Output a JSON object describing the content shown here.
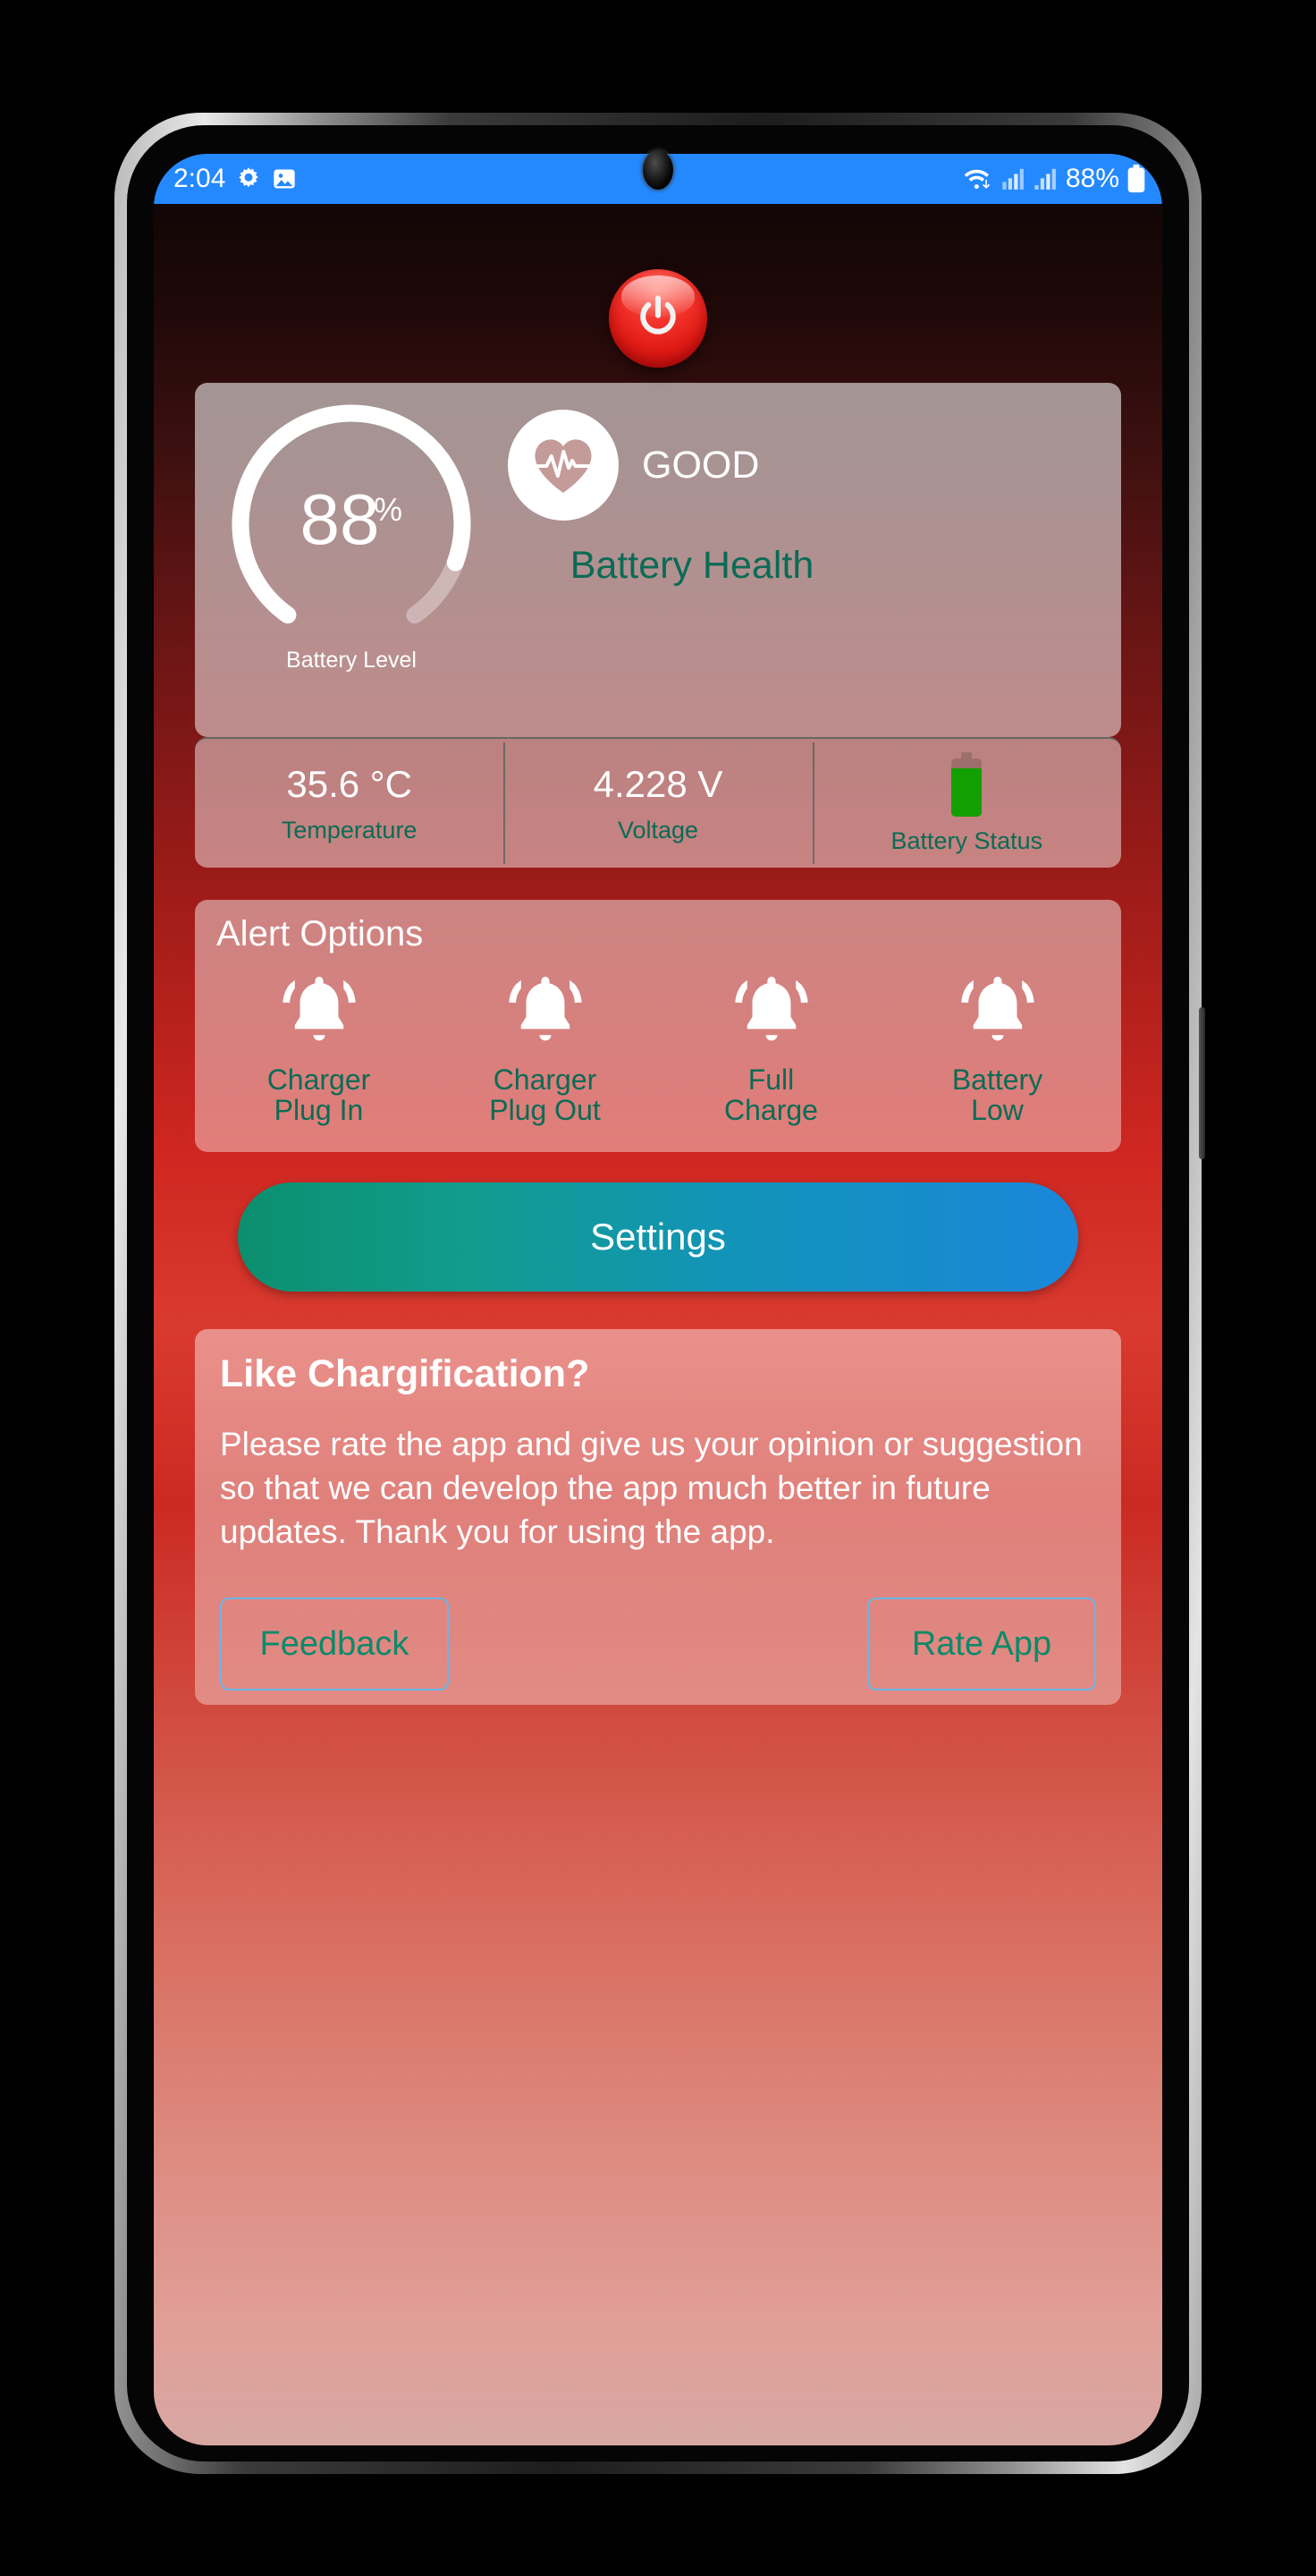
{
  "status_bar": {
    "time": "2:04",
    "left_icons": [
      "gear-icon",
      "image-icon"
    ],
    "battery_percent": "88%",
    "right_icons": [
      "wifi-icon",
      "signal-icon",
      "signal-icon",
      "battery-icon"
    ]
  },
  "power_button": {
    "icon": "power-icon"
  },
  "status_card": {
    "gauge": {
      "value": "88",
      "unit": "%",
      "label": "Battery Level",
      "percent": 88
    },
    "health": {
      "icon": "heart-pulse-icon",
      "value": "GOOD",
      "caption": "Battery Health"
    }
  },
  "metrics": [
    {
      "value": "35.6 °C",
      "label": "Temperature",
      "icon": null
    },
    {
      "value": "4.228 V",
      "label": "Voltage",
      "icon": null
    },
    {
      "value": "",
      "label": "Battery Status",
      "icon": "battery-vertical-icon"
    }
  ],
  "alerts": {
    "title": "Alert Options",
    "items": [
      {
        "icon": "bell-ring-icon",
        "label": "Charger\nPlug In"
      },
      {
        "icon": "bell-ring-icon",
        "label": "Charger\nPlug Out"
      },
      {
        "icon": "bell-ring-icon",
        "label": "Full\nCharge"
      },
      {
        "icon": "bell-ring-icon",
        "label": "Battery\nLow"
      }
    ]
  },
  "settings_button": {
    "label": "Settings"
  },
  "rate_card": {
    "title": "Like Chargification?",
    "body": "Please rate the app and give us your opinion or suggestion so that we can develop the app much better in future updates. Thank you for using the app.",
    "feedback_label": "Feedback",
    "rate_label": "Rate App"
  },
  "colors": {
    "status_bar": "#2489ff",
    "accent_teal": "#0a6b55",
    "power_red": "#e11b16",
    "settings_gradient_start": "#0b8f6e",
    "settings_gradient_end": "#1a87da",
    "outline_blue": "#6ab6e8",
    "battery_green": "#12a000"
  }
}
